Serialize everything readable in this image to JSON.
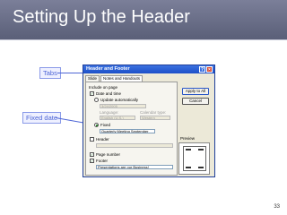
{
  "slide": {
    "title": "Setting Up the Header",
    "page_number": "33"
  },
  "callouts": {
    "tabs": "Tabs",
    "fixed_date": "Fixed date"
  },
  "dialog": {
    "title": "Header and Footer",
    "tabs": [
      {
        "label": "Slide",
        "active": false
      },
      {
        "label": "Notes and Handouts",
        "active": true
      }
    ],
    "group_label": "Include on page",
    "date_time": {
      "label": "Date and time",
      "checked": true
    },
    "update_auto": {
      "label": "Update automatically",
      "selected": false
    },
    "auto_value": "3/24/2005",
    "language_label": "Language:",
    "language_value": "English (U.S.)",
    "calendar_label": "Calendar type:",
    "calendar_value": "Western",
    "fixed": {
      "label": "Fixed",
      "selected": true,
      "value": "Quarterly Meeting September"
    },
    "header": {
      "label": "Header",
      "checked": false
    },
    "page_number": {
      "label": "Page number",
      "checked": true
    },
    "footer": {
      "label": "Footer",
      "checked": true,
      "value": "Presentations are our Business!"
    },
    "buttons": {
      "apply_all": "Apply to All",
      "cancel": "Cancel"
    },
    "preview_label": "Preview"
  }
}
